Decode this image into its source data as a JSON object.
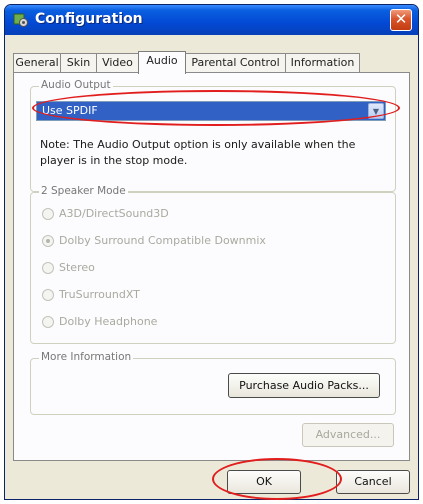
{
  "window": {
    "title": "Configuration",
    "close_glyph": "✕"
  },
  "tabs": [
    {
      "label": "General",
      "active": false
    },
    {
      "label": "Skin",
      "active": false
    },
    {
      "label": "Video",
      "active": false
    },
    {
      "label": "Audio",
      "active": true
    },
    {
      "label": "Parental Control",
      "active": false
    },
    {
      "label": "Information",
      "active": false
    }
  ],
  "audio_output": {
    "group_label": "Audio Output",
    "selected": "Use SPDIF",
    "arrow": "▼",
    "note": "Note:  The Audio Output option is only available when the player is in the stop mode."
  },
  "speaker_mode": {
    "group_label": "2 Speaker Mode",
    "options": [
      {
        "label": "A3D/DirectSound3D",
        "checked": false
      },
      {
        "label": "Dolby Surround Compatible Downmix",
        "checked": true
      },
      {
        "label": "Stereo",
        "checked": false
      },
      {
        "label": "TruSurroundXT",
        "checked": false
      },
      {
        "label": "Dolby Headphone",
        "checked": false
      }
    ]
  },
  "more_info": {
    "group_label": "More Information",
    "purchase_label": "Purchase Audio Packs..."
  },
  "advanced_label": "Advanced...",
  "buttons": {
    "ok": "OK",
    "cancel": "Cancel"
  },
  "icons": {
    "app": "config-gear-icon",
    "close": "close-icon",
    "dropdown": "chevron-down-icon"
  },
  "colors": {
    "titlebar": "#0349d4",
    "selection": "#3161c4",
    "highlight_oval": "#e11d1d"
  }
}
